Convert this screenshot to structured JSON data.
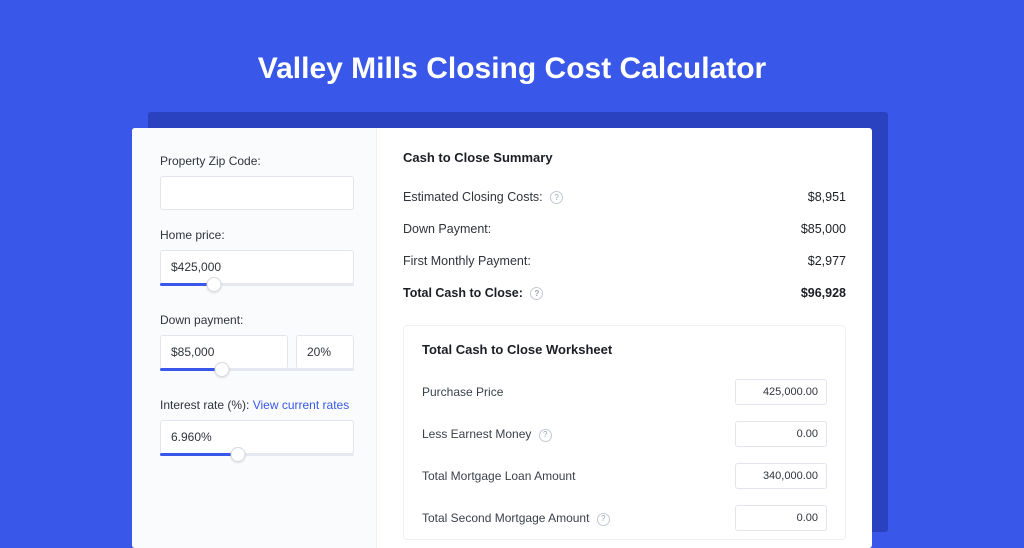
{
  "title": "Valley Mills Closing Cost Calculator",
  "left": {
    "zip": {
      "label": "Property Zip Code:",
      "value": ""
    },
    "home_price": {
      "label": "Home price:",
      "value": "$425,000",
      "slider_pct": 28
    },
    "down_payment": {
      "label": "Down payment:",
      "value": "$85,000",
      "pct": "20%",
      "slider_pct": 32
    },
    "interest": {
      "label": "Interest rate (%):",
      "link": "View current rates",
      "value": "6.960%",
      "slider_pct": 40
    }
  },
  "summary": {
    "title": "Cash to Close Summary",
    "rows": [
      {
        "label": "Estimated Closing Costs:",
        "help": true,
        "value": "$8,951"
      },
      {
        "label": "Down Payment:",
        "help": false,
        "value": "$85,000"
      },
      {
        "label": "First Monthly Payment:",
        "help": false,
        "value": "$2,977"
      }
    ],
    "total": {
      "label": "Total Cash to Close:",
      "help": true,
      "value": "$96,928"
    }
  },
  "worksheet": {
    "title": "Total Cash to Close Worksheet",
    "rows": [
      {
        "label": "Purchase Price",
        "help": false,
        "value": "425,000.00"
      },
      {
        "label": "Less Earnest Money",
        "help": true,
        "value": "0.00"
      },
      {
        "label": "Total Mortgage Loan Amount",
        "help": false,
        "value": "340,000.00"
      },
      {
        "label": "Total Second Mortgage Amount",
        "help": true,
        "value": "0.00"
      }
    ]
  }
}
